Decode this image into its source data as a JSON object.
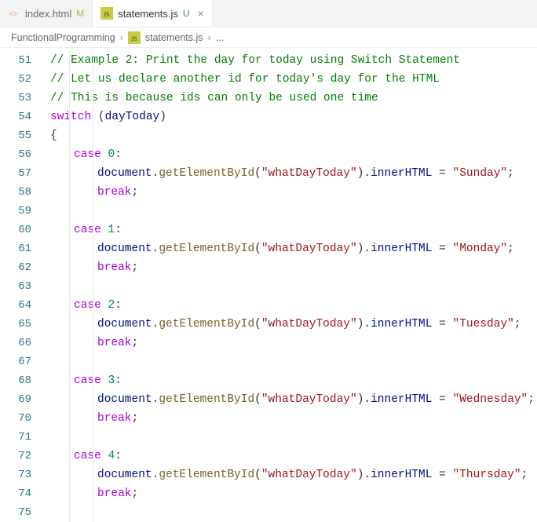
{
  "tabs": [
    {
      "filename": "index.html",
      "status": "M",
      "iconColor": "#e37933"
    },
    {
      "filename": "statements.js",
      "status": "U",
      "iconColor": "#cbcb41"
    }
  ],
  "activeTab": 1,
  "breadcrumb": {
    "parts": [
      "FunctionalProgramming",
      "statements.js",
      "..."
    ],
    "icons": [
      "",
      "js",
      "ellipsis"
    ]
  },
  "startLine": 51,
  "lines": [
    {
      "n": 51,
      "indent": 0,
      "tokens": [
        [
          "comment",
          "// Example 2: Print the day for today using Switch Statement"
        ]
      ]
    },
    {
      "n": 52,
      "indent": 0,
      "tokens": [
        [
          "comment",
          "// Let us declare another id for today's day for the HTML"
        ]
      ]
    },
    {
      "n": 53,
      "indent": 0,
      "tokens": [
        [
          "comment",
          "// This is because ids can only be used one time"
        ]
      ]
    },
    {
      "n": 54,
      "indent": 0,
      "tokens": [
        [
          "keyword",
          "switch"
        ],
        [
          "punc",
          " ("
        ],
        [
          "var",
          "dayToday"
        ],
        [
          "punc",
          ")"
        ]
      ]
    },
    {
      "n": 55,
      "indent": 0,
      "tokens": [
        [
          "brace",
          "{"
        ]
      ]
    },
    {
      "n": 56,
      "indent": 1,
      "tokens": [
        [
          "keyword",
          "case"
        ],
        [
          "punc",
          " "
        ],
        [
          "num",
          "0"
        ],
        [
          "punc",
          ":"
        ]
      ]
    },
    {
      "n": 57,
      "indent": 2,
      "tokens": [
        [
          "var",
          "document"
        ],
        [
          "punc",
          "."
        ],
        [
          "func",
          "getElementById"
        ],
        [
          "punc",
          "("
        ],
        [
          "string",
          "\"whatDayToday\""
        ],
        [
          "punc",
          ")."
        ],
        [
          "prop",
          "innerHTML"
        ],
        [
          "op",
          " = "
        ],
        [
          "string",
          "\"Sunday\""
        ],
        [
          "punc",
          ";"
        ]
      ]
    },
    {
      "n": 58,
      "indent": 2,
      "tokens": [
        [
          "keyword",
          "break"
        ],
        [
          "punc",
          ";"
        ]
      ]
    },
    {
      "n": 59,
      "indent": 0,
      "tokens": []
    },
    {
      "n": 60,
      "indent": 1,
      "tokens": [
        [
          "keyword",
          "case"
        ],
        [
          "punc",
          " "
        ],
        [
          "num",
          "1"
        ],
        [
          "punc",
          ":"
        ]
      ]
    },
    {
      "n": 61,
      "indent": 2,
      "tokens": [
        [
          "var",
          "document"
        ],
        [
          "punc",
          "."
        ],
        [
          "func",
          "getElementById"
        ],
        [
          "punc",
          "("
        ],
        [
          "string",
          "\"whatDayToday\""
        ],
        [
          "punc",
          ")."
        ],
        [
          "prop",
          "innerHTML"
        ],
        [
          "op",
          " = "
        ],
        [
          "string",
          "\"Monday\""
        ],
        [
          "punc",
          ";"
        ]
      ]
    },
    {
      "n": 62,
      "indent": 2,
      "tokens": [
        [
          "keyword",
          "break"
        ],
        [
          "punc",
          ";"
        ]
      ]
    },
    {
      "n": 63,
      "indent": 0,
      "tokens": []
    },
    {
      "n": 64,
      "indent": 1,
      "tokens": [
        [
          "keyword",
          "case"
        ],
        [
          "punc",
          " "
        ],
        [
          "num",
          "2"
        ],
        [
          "punc",
          ":"
        ]
      ]
    },
    {
      "n": 65,
      "indent": 2,
      "tokens": [
        [
          "var",
          "document"
        ],
        [
          "punc",
          "."
        ],
        [
          "func",
          "getElementById"
        ],
        [
          "punc",
          "("
        ],
        [
          "string",
          "\"whatDayToday\""
        ],
        [
          "punc",
          ")."
        ],
        [
          "prop",
          "innerHTML"
        ],
        [
          "op",
          " = "
        ],
        [
          "string",
          "\"Tuesday\""
        ],
        [
          "punc",
          ";"
        ]
      ]
    },
    {
      "n": 66,
      "indent": 2,
      "tokens": [
        [
          "keyword",
          "break"
        ],
        [
          "punc",
          ";"
        ]
      ]
    },
    {
      "n": 67,
      "indent": 0,
      "tokens": []
    },
    {
      "n": 68,
      "indent": 1,
      "tokens": [
        [
          "keyword",
          "case"
        ],
        [
          "punc",
          " "
        ],
        [
          "num",
          "3"
        ],
        [
          "punc",
          ":"
        ]
      ]
    },
    {
      "n": 69,
      "indent": 2,
      "tokens": [
        [
          "var",
          "document"
        ],
        [
          "punc",
          "."
        ],
        [
          "func",
          "getElementById"
        ],
        [
          "punc",
          "("
        ],
        [
          "string",
          "\"whatDayToday\""
        ],
        [
          "punc",
          ")."
        ],
        [
          "prop",
          "innerHTML"
        ],
        [
          "op",
          " = "
        ],
        [
          "string",
          "\"Wednesday\""
        ],
        [
          "punc",
          ";"
        ]
      ]
    },
    {
      "n": 70,
      "indent": 2,
      "tokens": [
        [
          "keyword",
          "break"
        ],
        [
          "punc",
          ";"
        ]
      ]
    },
    {
      "n": 71,
      "indent": 0,
      "tokens": []
    },
    {
      "n": 72,
      "indent": 1,
      "tokens": [
        [
          "keyword",
          "case"
        ],
        [
          "punc",
          " "
        ],
        [
          "num",
          "4"
        ],
        [
          "punc",
          ":"
        ]
      ]
    },
    {
      "n": 73,
      "indent": 2,
      "tokens": [
        [
          "var",
          "document"
        ],
        [
          "punc",
          "."
        ],
        [
          "func",
          "getElementById"
        ],
        [
          "punc",
          "("
        ],
        [
          "string",
          "\"whatDayToday\""
        ],
        [
          "punc",
          ")."
        ],
        [
          "prop",
          "innerHTML"
        ],
        [
          "op",
          " = "
        ],
        [
          "string",
          "\"Thursday\""
        ],
        [
          "punc",
          ";"
        ]
      ]
    },
    {
      "n": 74,
      "indent": 2,
      "tokens": [
        [
          "keyword",
          "break"
        ],
        [
          "punc",
          ";"
        ]
      ]
    },
    {
      "n": 75,
      "indent": 0,
      "tokens": []
    }
  ]
}
